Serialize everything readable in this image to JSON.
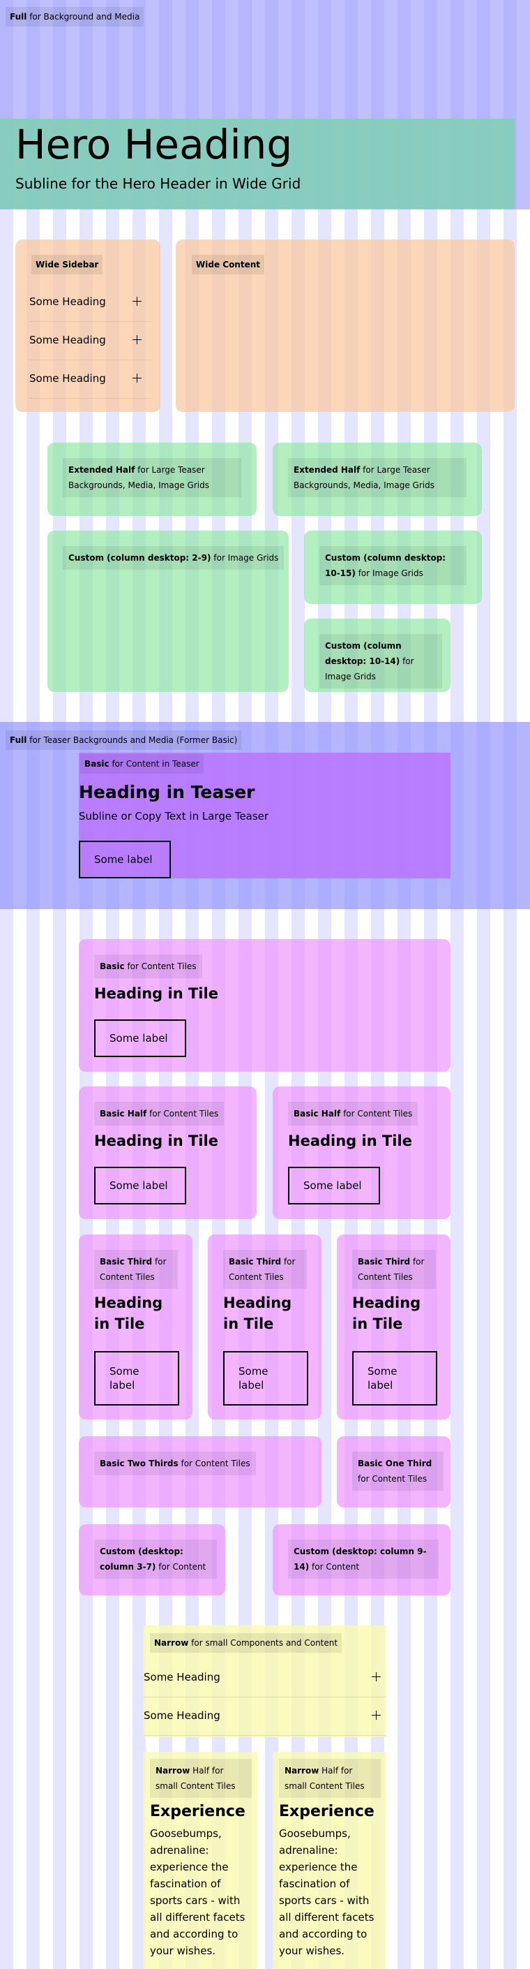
{
  "full_bg": {
    "bold": "Full",
    "rest": " for Background and Media"
  },
  "hero": {
    "heading": "Hero Heading",
    "subline": "Subline for the Hero Header in Wide Grid"
  },
  "wide_sidebar": {
    "label": "Wide Sidebar",
    "items": [
      "Some Heading",
      "Some Heading",
      "Some Heading"
    ]
  },
  "wide_content": {
    "label": "Wide Content"
  },
  "ext_half_1": {
    "bold": "Extended Half",
    "rest": " for Large Teaser Backgrounds, Media, Image Grids"
  },
  "ext_half_2": {
    "bold": "Extended Half",
    "rest": " for Large Teaser Backgrounds, Media, Image Grids"
  },
  "custom_2_9": {
    "bold": "Custom (column desktop: 2-9)",
    "rest": " for Image Grids"
  },
  "custom_10_15": {
    "bold": "Custom (column desktop: 10-15)",
    "rest": " for Image Grids"
  },
  "custom_10_14": {
    "bold": "Custom (column desktop: 10-14)",
    "rest": " for Image Grids"
  },
  "full_teaser": {
    "bold": "Full",
    "rest": " for Teaser Backgrounds and Media (Former Basic)"
  },
  "teaser": {
    "bold": "Basic",
    "rest": " for Content in Teaser",
    "heading": "Heading in Teaser",
    "subline": "Subline or Copy Text in Large Teaser",
    "button": "Some label"
  },
  "basic_tile": {
    "bold": "Basic",
    "rest": " for Content Tiles",
    "heading": "Heading in Tile",
    "button": "Some label"
  },
  "half_tiles": [
    {
      "bold": "Basic Half",
      "rest": " for Content Tiles",
      "heading": "Heading in Tile",
      "button": "Some label"
    },
    {
      "bold": "Basic Half",
      "rest": " for Content Tiles",
      "heading": "Heading in Tile",
      "button": "Some label"
    }
  ],
  "third_tiles": [
    {
      "bold": "Basic Third",
      "rest": " for Content Tiles",
      "heading": "Heading in Tile",
      "button": "Some label"
    },
    {
      "bold": "Basic Third",
      "rest": " for Content Tiles",
      "heading": "Heading in Tile",
      "button": "Some label"
    },
    {
      "bold": "Basic Third",
      "rest": " for Content Tiles",
      "heading": "Heading in Tile",
      "button": "Some label"
    }
  ],
  "two_thirds": {
    "bold": "Basic Two Thirds",
    "rest": " for Content Tiles"
  },
  "one_third": {
    "bold": "Basic One Third",
    "rest": " for Content Tiles"
  },
  "custom_3_7": {
    "bold": "Custom (desktop: column 3-7)",
    "rest": " for Content"
  },
  "custom_9_14": {
    "bold": "Custom (desktop: column 9-14)",
    "rest": " for Content"
  },
  "narrow": {
    "bold": "Narrow",
    "rest": " for small Components and Content",
    "items": [
      "Some Heading",
      "Some Heading"
    ]
  },
  "narrow_halves": [
    {
      "bold": "Narrow",
      "rest": " Half for small Content Tiles",
      "heading": "Experience",
      "text": "Goosebumps, adrenaline: experience the fascination of sports cars - with all different facets and according to your wishes."
    },
    {
      "bold": "Narrow",
      "rest": " Half for small Content Tiles",
      "heading": "Experience",
      "text": "Goosebumps, adrenaline: experience the fascination of sports cars - with all different facets and according to your wishes."
    }
  ]
}
